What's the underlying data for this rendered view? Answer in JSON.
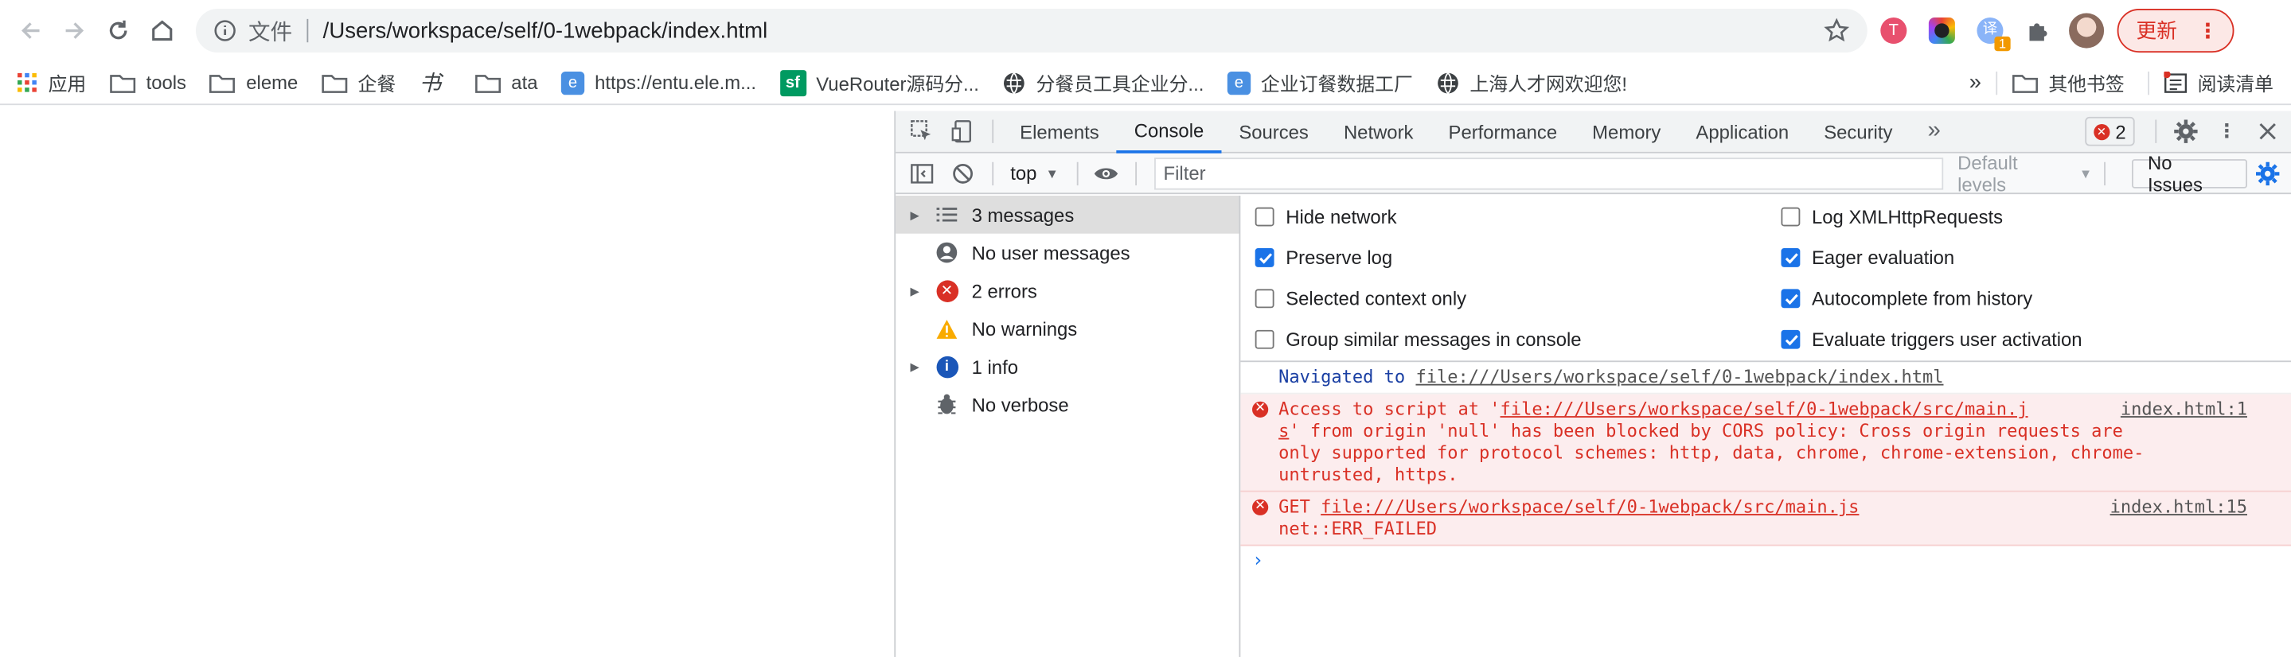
{
  "browser": {
    "url_scheme": "文件",
    "url": "/Users/workspace/self/0-1webpack/index.html",
    "update_label": "更新",
    "ext_badge": "1"
  },
  "bookmarks": {
    "items": [
      "应用",
      "tools",
      "eleme",
      "企餐",
      "",
      "ata",
      "https://entu.ele.m...",
      "VueRouter源码分...",
      "分餐员工具企业分...",
      "企业订餐数据工厂",
      "上海人才网欢迎您!"
    ],
    "more": "»",
    "other": "其他书签",
    "reading": "阅读清单"
  },
  "devtools": {
    "tabs": [
      "Elements",
      "Console",
      "Sources",
      "Network",
      "Performance",
      "Memory",
      "Application",
      "Security"
    ],
    "tabs_more": "»",
    "error_count": "2",
    "context": "top",
    "filter_placeholder": "Filter",
    "levels": "Default levels",
    "issues": "No Issues",
    "sidebar": [
      "3 messages",
      "No user messages",
      "2 errors",
      "No warnings",
      "1 info",
      "No verbose"
    ],
    "settings": {
      "hide_network": "Hide network",
      "preserve_log": "Preserve log",
      "selected_context": "Selected context only",
      "group_similar": "Group similar messages in console",
      "log_xhr": "Log XMLHttpRequests",
      "eager_eval": "Eager evaluation",
      "autocomplete": "Autocomplete from history",
      "evaluate_triggers": "Evaluate triggers user activation"
    },
    "console": {
      "nav_text": "Navigated to ",
      "nav_link": "file:///Users/workspace/self/0-1webpack/index.html",
      "err1_pre": "Access to script at '",
      "err1_link": "file:///Users/workspace/self/0-1webpack/src/main.j",
      "err1_link2": "s",
      "err1_post": "' from origin 'null' has been blocked by CORS policy: Cross origin requests are only supported for protocol schemes: http, data, chrome, chrome-extension, chrome-untrusted, https.",
      "err1_src": "index.html:1",
      "err2_pre": "GET ",
      "err2_link": "file:///Users/workspace/self/0-1webpack/src/main.js",
      "err2_line2": "net::ERR_FAILED",
      "err2_src": "index.html:15",
      "prompt": "›"
    }
  },
  "colors": {
    "accent": "#1a73e8",
    "error": "#d93025"
  }
}
